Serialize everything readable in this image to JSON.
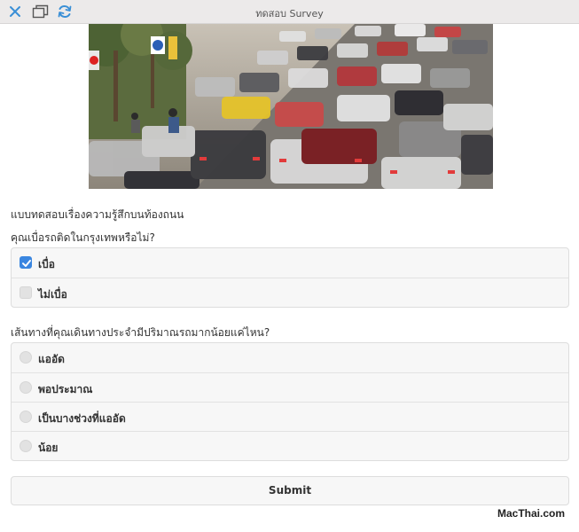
{
  "window": {
    "title": "ทดสอบ Survey",
    "close_icon": "close-icon",
    "tabs_icon": "windows-icon",
    "reload_icon": "reload-icon",
    "icon_color": "#3a8fd6"
  },
  "hero": {
    "image": "traffic-jam-photo"
  },
  "survey": {
    "title": "แบบทดสอบเรื่องความรู้สึกบนท้องถนน",
    "questions": [
      {
        "text": "คุณเบื่อรถติดในกรุงเทพหรือไม่?",
        "type": "checkbox",
        "options": [
          {
            "label": "เบื่อ",
            "checked": true
          },
          {
            "label": "ไม่เบื่อ",
            "checked": false
          }
        ]
      },
      {
        "text": "เส้นทางที่คุณเดินทางประจำมีปริมาณรถมากน้อยแค่ไหน?",
        "type": "radio",
        "options": [
          {
            "label": "แออัด",
            "checked": false
          },
          {
            "label": "พอประมาณ",
            "checked": false
          },
          {
            "label": "เป็นบางช่วงที่แออัด",
            "checked": false
          },
          {
            "label": "น้อย",
            "checked": false
          }
        ]
      }
    ],
    "submit_label": "Submit"
  },
  "watermark": "MacThai.com",
  "colors": {
    "accent": "#3a86e0",
    "option_background": "#f7f7f7",
    "border": "#dddddd"
  }
}
